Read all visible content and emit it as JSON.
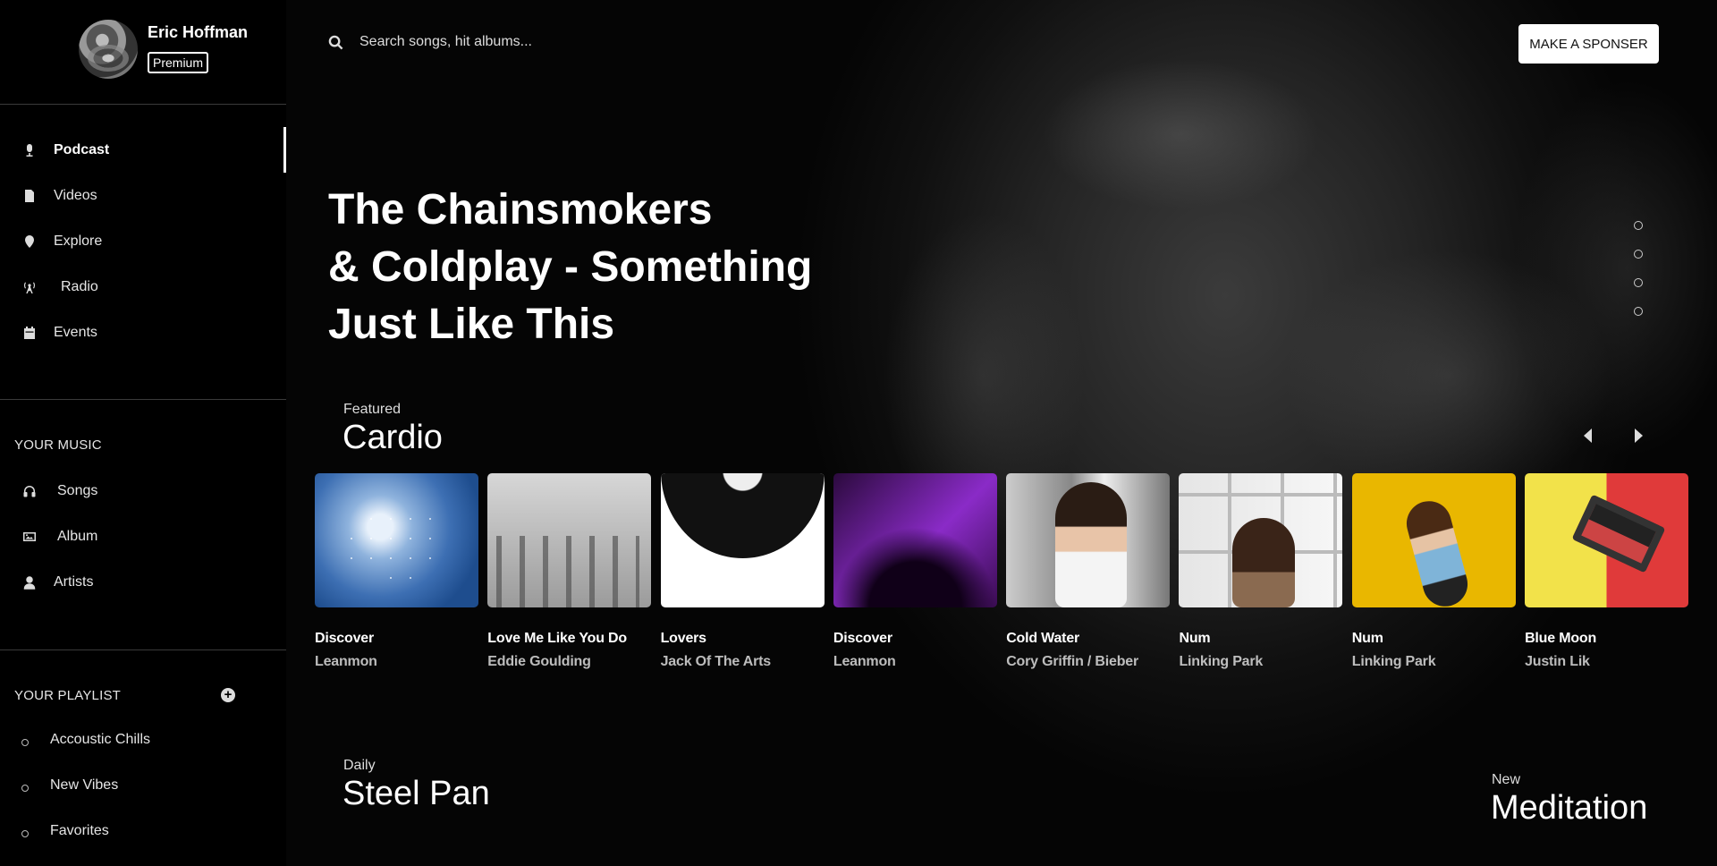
{
  "user": {
    "name": "Eric Hoffman",
    "badge": "Premium"
  },
  "nav": [
    {
      "label": "Podcast",
      "icon": "microphone-icon",
      "active": true
    },
    {
      "label": "Videos",
      "icon": "file-icon"
    },
    {
      "label": "Explore",
      "icon": "map-pin-icon"
    },
    {
      "label": "Radio",
      "icon": "radio-tower-icon"
    },
    {
      "label": "Events",
      "icon": "calendar-icon"
    }
  ],
  "your_music": {
    "title": "YOUR MUSIC",
    "items": [
      {
        "label": "Songs",
        "icon": "headphones-icon"
      },
      {
        "label": "Album",
        "icon": "image-icon"
      },
      {
        "label": "Artists",
        "icon": "user-icon"
      }
    ]
  },
  "your_playlist": {
    "title": "YOUR PLAYLIST",
    "items": [
      {
        "label": "Accoustic Chills"
      },
      {
        "label": "New Vibes"
      },
      {
        "label": "Favorites"
      }
    ]
  },
  "search": {
    "placeholder": "Search songs, hit albums..."
  },
  "sponsor_button": "MAKE A SPONSER",
  "hero": {
    "lines": [
      "The Chainsmokers",
      "& Coldplay - Something",
      "Just Like This"
    ],
    "slides": 4
  },
  "featured": {
    "label": "Featured",
    "title": "Cardio",
    "cards": [
      {
        "title": "Discover",
        "artist": "Leanmon"
      },
      {
        "title": "Love Me Like You Do",
        "artist": "Eddie Goulding"
      },
      {
        "title": "Lovers",
        "artist": "Jack Of The Arts"
      },
      {
        "title": "Discover",
        "artist": "Leanmon"
      },
      {
        "title": "Cold Water",
        "artist": "Cory Griffin / Bieber"
      },
      {
        "title": "Num",
        "artist": "Linking Park"
      },
      {
        "title": "Num",
        "artist": "Linking Park"
      },
      {
        "title": "Blue Moon",
        "artist": "Justin Lik"
      }
    ]
  },
  "daily": {
    "label": "Daily",
    "title": "Steel Pan"
  },
  "new_section": {
    "label": "New",
    "title": "Meditation"
  }
}
